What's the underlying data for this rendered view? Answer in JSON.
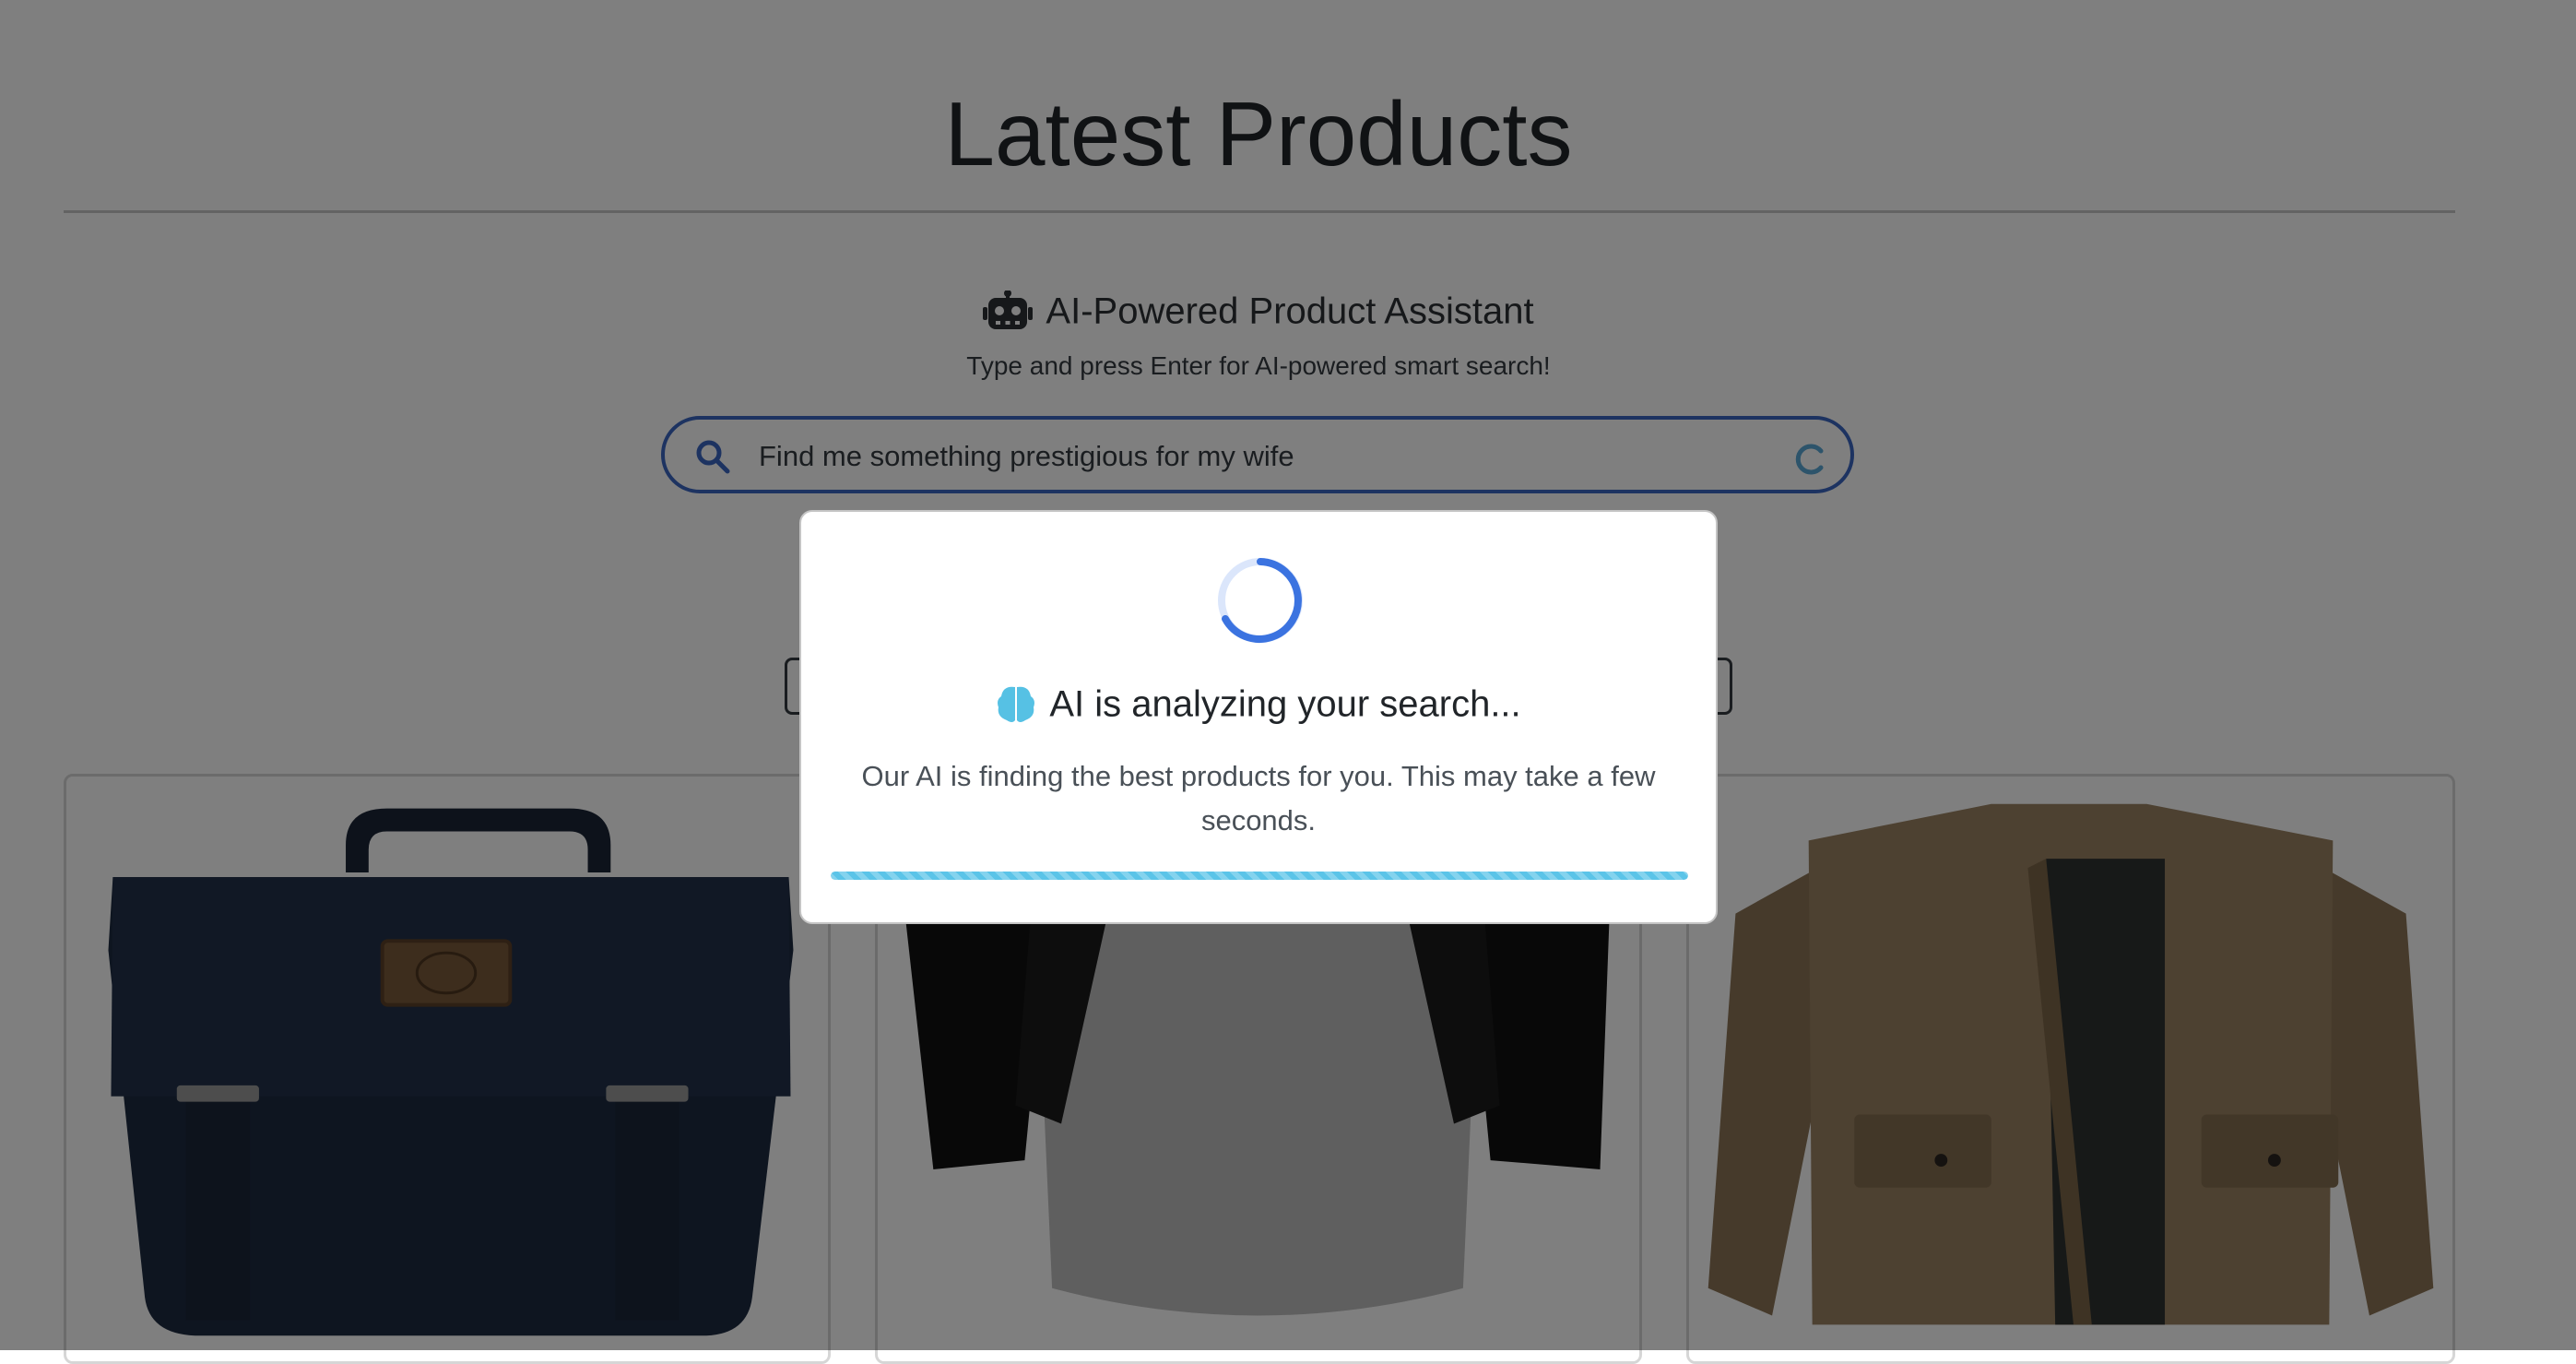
{
  "page": {
    "title": "Latest Products"
  },
  "assistant": {
    "heading": "AI-Powered Product Assistant",
    "subtitle": "Type and press Enter for AI-powered smart search!",
    "robot_icon": "robot-icon"
  },
  "search": {
    "value": "Find me something prestigious for my wife",
    "search_icon": "search-icon",
    "loading_icon": "loading-spinner-icon",
    "accent_color": "#3a66c2"
  },
  "products": [
    {
      "name": "product-card-messenger-bag",
      "image_icon": "navy-messenger-bag-image"
    },
    {
      "name": "product-card-raglan-shirt",
      "image_icon": "raglan-tshirt-image"
    },
    {
      "name": "product-card-jacket",
      "image_icon": "khaki-jacket-image"
    }
  ],
  "modal": {
    "title": "AI is analyzing your search...",
    "message": "Our AI is finding the best products for you. This may take a few seconds.",
    "brain_icon": "brain-icon",
    "spinner_color": "#3b73e0",
    "progress": 1.0,
    "progress_color": "#5bc4e8"
  },
  "colors": {
    "overlay": "rgba(0,0,0,0.5)",
    "text": "#212529"
  }
}
